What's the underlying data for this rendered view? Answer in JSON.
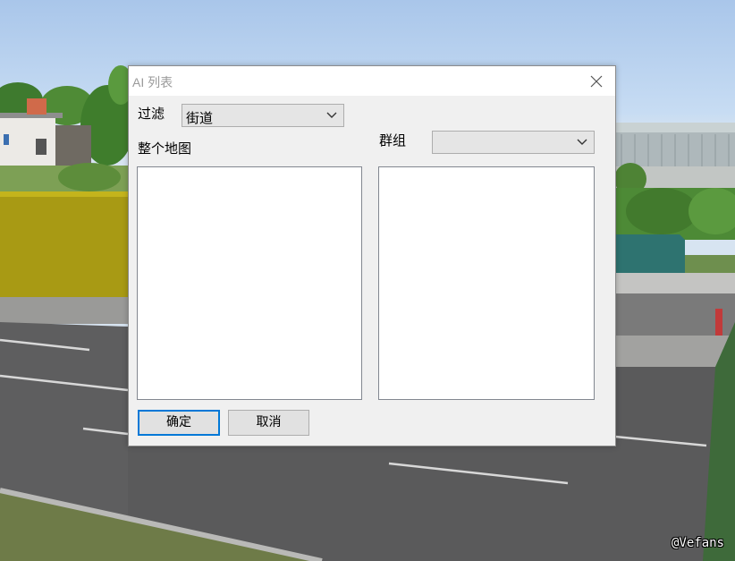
{
  "dialog": {
    "title": "AI 列表",
    "filter_label": "过滤",
    "filter_value": "街道",
    "scope_label": "整个地图",
    "group_label": "群组",
    "group_value": "",
    "ok_label": "确定",
    "cancel_label": "取消"
  },
  "icons": {
    "close": "close-icon",
    "dropdown": "chevron-down-icon"
  },
  "watermark": "@Vefans"
}
